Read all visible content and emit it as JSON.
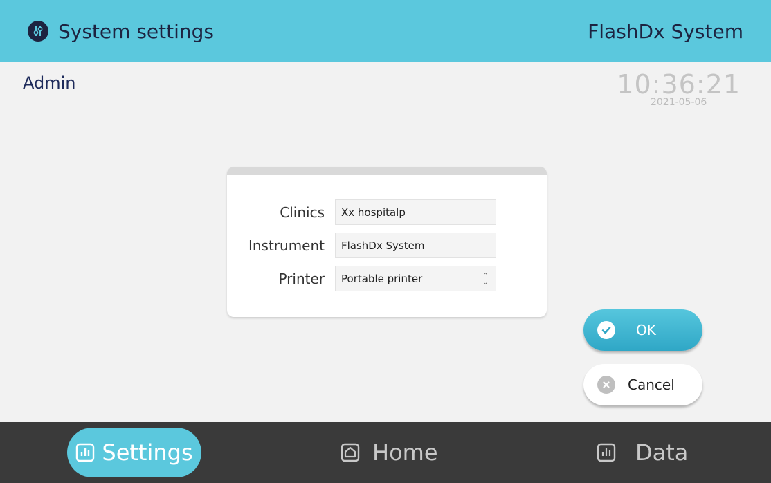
{
  "header": {
    "title": "System settings",
    "brand": "FlashDx System"
  },
  "user": {
    "name": "Admin"
  },
  "clock": {
    "time": "10:36:21",
    "date": "2021-05-06"
  },
  "form": {
    "clinics_label": "Clinics",
    "clinics_value": "Xx hospitalp",
    "instrument_label": "Instrument",
    "instrument_value": "FlashDx System",
    "printer_label": "Printer",
    "printer_value": "Portable printer"
  },
  "buttons": {
    "ok": "OK",
    "cancel": "Cancel"
  },
  "nav": {
    "settings": "Settings",
    "home": "Home",
    "data": "Data"
  },
  "colors": {
    "accent": "#5bc8dd",
    "footer": "#3a3a3a",
    "ok_gradient_end": "#2fa7c6"
  }
}
